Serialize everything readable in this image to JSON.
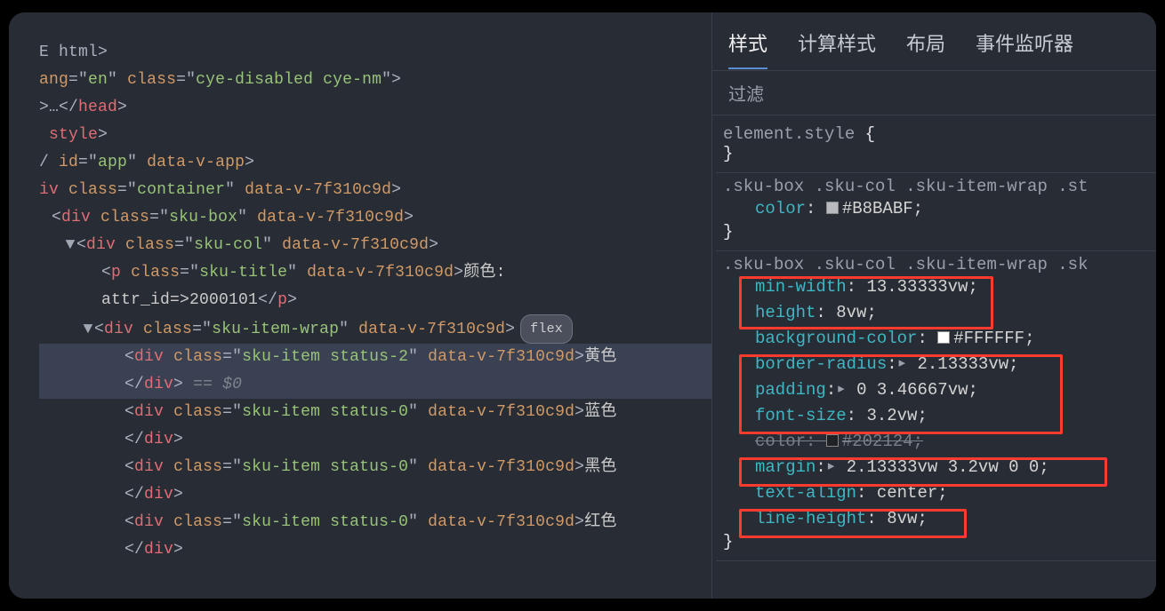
{
  "tabs": {
    "styles": "样式",
    "computed": "计算样式",
    "layout": "布局",
    "listeners": "事件监听器"
  },
  "filter_placeholder": "过滤",
  "dom": {
    "l1": "E html>",
    "l2_tag": "",
    "l2_attr1": "ang",
    "l2_val1": "en",
    "l2_attr2": "class",
    "l2_val2": "cye-disabled cye-nm",
    "l3_open": ">…</",
    "l3_close": "head",
    "l4_tag": "style",
    "l5_pre": "/ ",
    "l5_attr1": "id",
    "l5_val1": "app",
    "l5_attr2": "data-v-app",
    "l6_tag": "div",
    "l6_attr1": "class",
    "l6_val1": "container",
    "l6_attr2": "data-v-7f310c9d",
    "l7_tag": "div",
    "l7_attr1": "class",
    "l7_val1": "sku-box",
    "l7_attr2": "data-v-7f310c9d",
    "l8_tag": "div",
    "l8_attr1": "class",
    "l8_val1": "sku-col",
    "l8_attr2": "data-v-7f310c9d",
    "l9_tag": "p",
    "l9_attr1": "class",
    "l9_val1": "sku-title",
    "l9_attr2": "data-v-7f310c9d",
    "l9_text": "颜色:",
    "l10_text1": "attr_id=>",
    "l10_text2": "2000101",
    "l10_close": "p",
    "l11_tag": "div",
    "l11_attr1": "class",
    "l11_val1": "sku-item-wrap",
    "l11_attr2": "data-v-7f310c9d",
    "flex_badge": "flex",
    "l12_tag": "div",
    "l12_attr1": "class",
    "l12_val1": "sku-item status-2",
    "l12_attr2": "data-v-7f310c9d",
    "l12_text": "黄色",
    "l12_close": "div",
    "eq": "== $0",
    "l13_val1": "sku-item status-0",
    "l13_text": "蓝色",
    "l14_text": "黑色",
    "l15_text": "红色"
  },
  "rules": {
    "element_style": "element.style",
    "selector1": ".sku-box .sku-col .sku-item-wrap .st",
    "r1": {
      "p": "color",
      "v": "#B8BABF"
    },
    "selector2": ".sku-box .sku-col .sku-item-wrap .sk",
    "r2a": {
      "p": "min-width",
      "v": "13.33333vw"
    },
    "r2b": {
      "p": "height",
      "v": "8vw"
    },
    "r2c": {
      "p": "background-color",
      "v": "#FFFFFF"
    },
    "r2d": {
      "p": "border-radius",
      "v": "2.13333vw"
    },
    "r2e": {
      "p": "padding",
      "v": "0 3.46667vw"
    },
    "r2f": {
      "p": "font-size",
      "v": "3.2vw"
    },
    "r2g": {
      "p": "color",
      "v": "#202124"
    },
    "r2h": {
      "p": "margin",
      "v": "2.13333vw 3.2vw 0 0"
    },
    "r2i": {
      "p": "text-align",
      "v": "center"
    },
    "r2j": {
      "p": "line-height",
      "v": "8vw"
    }
  }
}
